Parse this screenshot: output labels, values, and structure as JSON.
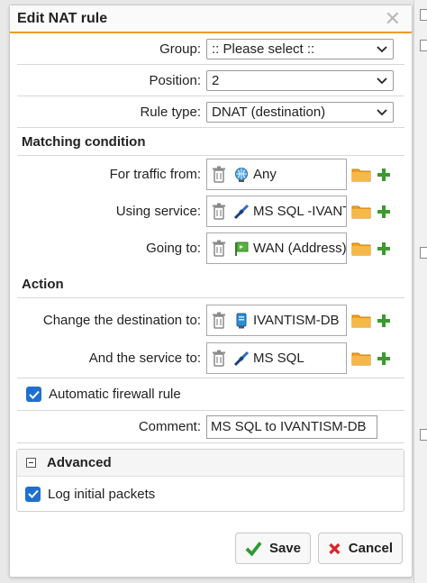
{
  "dialog": {
    "title": "Edit NAT rule",
    "close_glyph": "✕"
  },
  "fields": {
    "group": {
      "label": "Group:",
      "value": ":: Please select ::"
    },
    "position": {
      "label": "Position:",
      "value": "2"
    },
    "rule_type": {
      "label": "Rule type:",
      "value": "DNAT (destination)"
    }
  },
  "matching": {
    "heading": "Matching condition",
    "traffic_from": {
      "label": "For traffic from:",
      "value": "Any",
      "icon": "globe-network-icon"
    },
    "using_service": {
      "label": "Using service:",
      "value": "MS SQL -IVANTI",
      "icon": "service-plug-icon"
    },
    "going_to": {
      "label": "Going to:",
      "value": "WAN (Address)",
      "icon": "interface-flag-icon"
    }
  },
  "action": {
    "heading": "Action",
    "change_destination": {
      "label": "Change the destination to:",
      "value": "IVANTISM-DB",
      "icon": "host-server-icon"
    },
    "and_service": {
      "label": "And the service to:",
      "value": "MS SQL",
      "icon": "service-plug-icon"
    }
  },
  "auto_firewall": {
    "label": "Automatic firewall rule",
    "checked": true
  },
  "comment": {
    "label": "Comment:",
    "value": "MS SQL to IVANTISM-DB"
  },
  "advanced": {
    "heading": "Advanced",
    "log_initial": {
      "label": "Log initial packets",
      "checked": true
    }
  },
  "buttons": {
    "save": "Save",
    "cancel": "Cancel"
  },
  "colors": {
    "accent": "#f39a21",
    "checkbox": "#1f6fd0",
    "save_green": "#2e9b2e",
    "cancel_red": "#d9262c"
  }
}
